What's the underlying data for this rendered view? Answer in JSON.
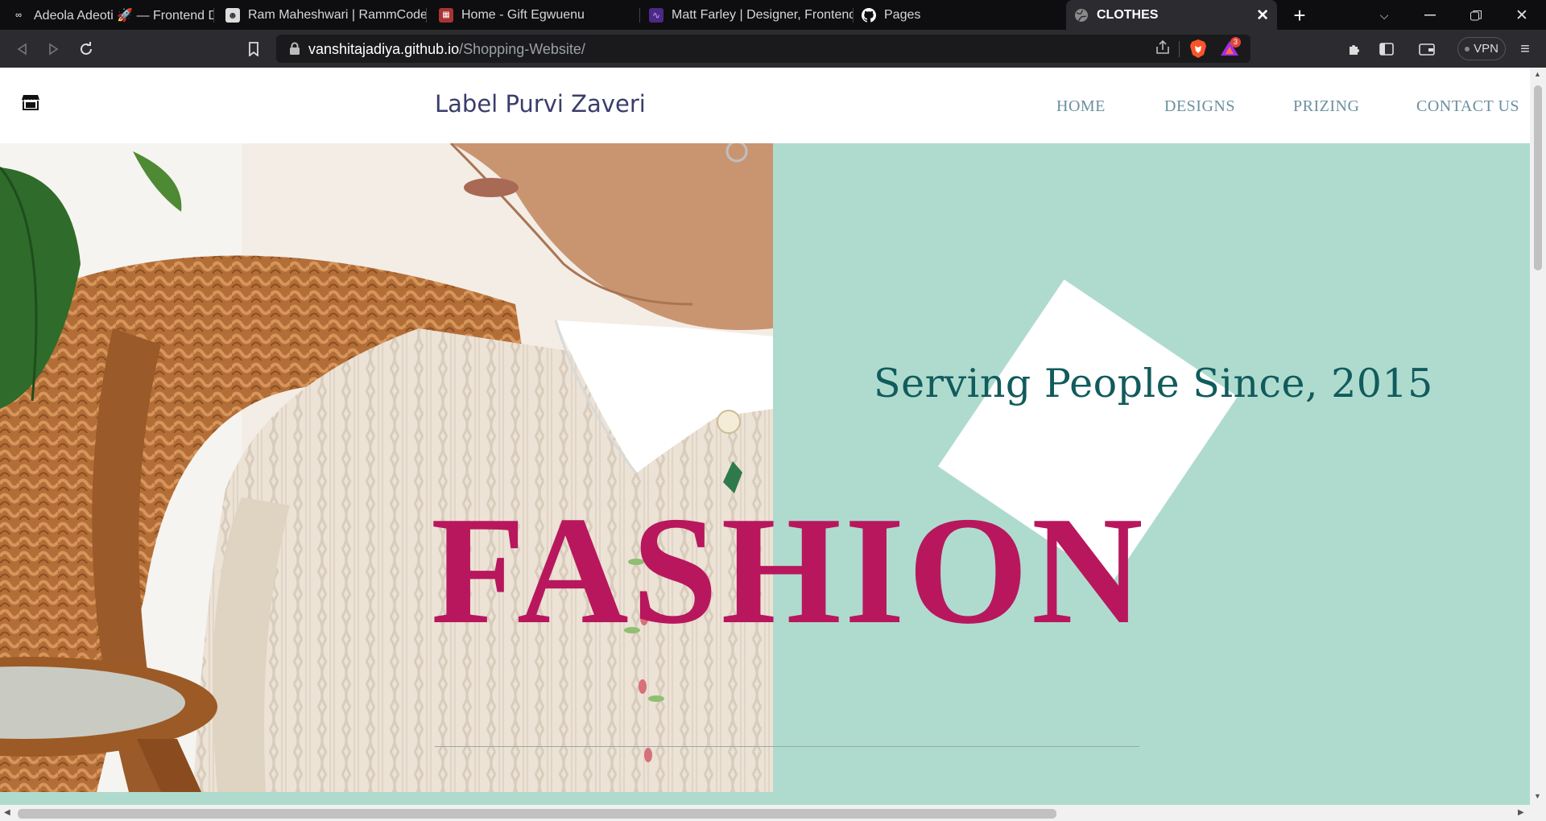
{
  "browser": {
    "tabs": [
      {
        "title": "Adeola Adeoti 🚀 — Frontend D",
        "icon": "adeola-favicon-icon"
      },
      {
        "title": "Ram Maheshwari | RammCodes |",
        "icon": "avatar-favicon-icon"
      },
      {
        "title": "Home - Gift Egwuenu",
        "icon": "gift-favicon-icon"
      },
      {
        "title": "Matt Farley | Designer, Frontend",
        "icon": "matt-favicon-icon"
      },
      {
        "title": "Pages",
        "icon": "github-icon"
      },
      {
        "title": "CLOTHES",
        "icon": "globe-icon",
        "active": true
      }
    ],
    "new_tab": "+",
    "url": {
      "domain": "vanshitajadiya.github.io",
      "path": "/Shopping-Website/"
    },
    "rewards_count": "3",
    "vpn_label": "VPN"
  },
  "site": {
    "brand": "Label Purvi Zaveri",
    "nav": [
      "HOME",
      "DESIGNS",
      "PRIZING",
      "CONTACT US"
    ],
    "tagline": "Serving People Since, 2015",
    "headline": "FASHION"
  },
  "colors": {
    "hero_bg": "#afdbcf",
    "headline": "#b8175d",
    "tagline": "#115b5c",
    "brand": "#3a3d6b",
    "nav": "#6b8fa0"
  }
}
